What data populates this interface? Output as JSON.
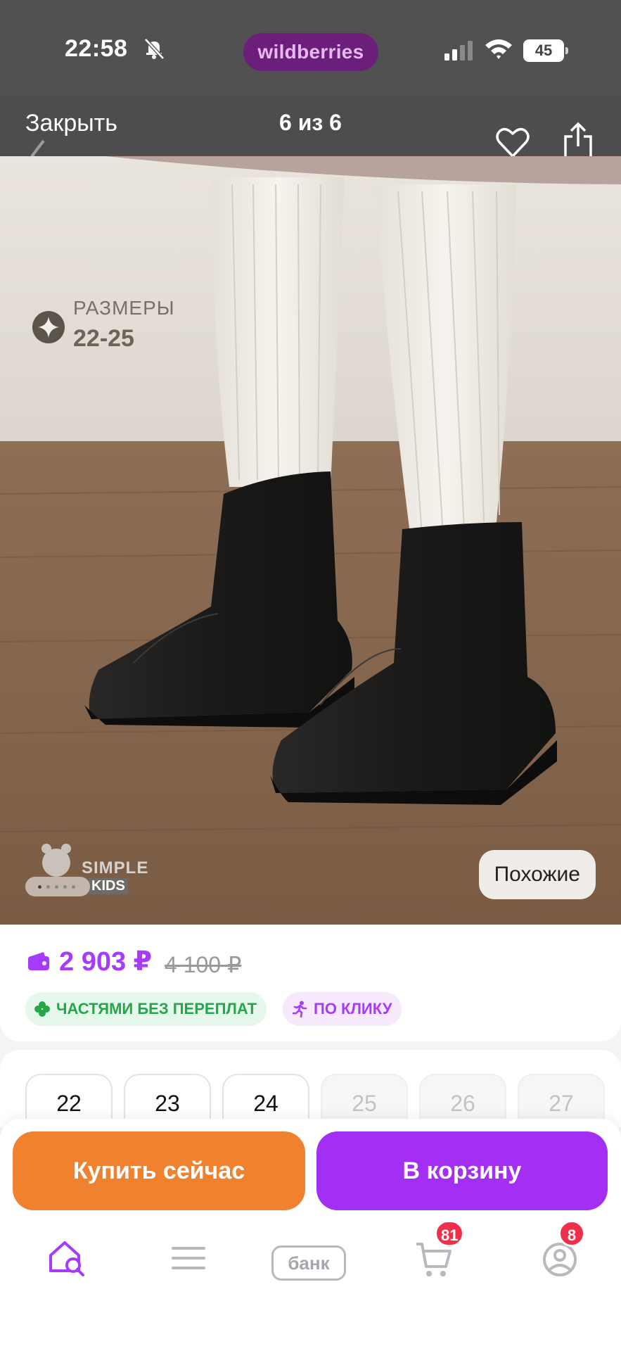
{
  "status_bar": {
    "time": "22:58",
    "brand": "wildberries",
    "battery": "45",
    "colors": {
      "bar": "#515151",
      "brand_pill": "#6b1f7a"
    }
  },
  "top_nav": {
    "close_label": "Закрыть",
    "counter": "6 из 6",
    "icons": [
      "chevron-left-icon",
      "heart-icon",
      "share-icon"
    ]
  },
  "photo": {
    "size_label": "РАЗМЕРЫ",
    "size_range": "22-25",
    "brand_name": "SIMPLE",
    "brand_sub": "KIDS",
    "similar_label": "Похожие"
  },
  "price": {
    "current": "2 903 ₽",
    "old": "4 100 ₽",
    "installments_tag": "ЧАСТЯМИ БЕЗ ПЕРЕПЛАТ",
    "click_tag": "ПО КЛИКУ",
    "colors": {
      "price": "#a73afd",
      "installments": "#26a64a"
    }
  },
  "sizes": [
    {
      "label": "22",
      "available": true
    },
    {
      "label": "23",
      "available": true
    },
    {
      "label": "24",
      "available": true
    },
    {
      "label": "25",
      "available": false
    },
    {
      "label": "26",
      "available": false
    },
    {
      "label": "27",
      "available": false
    }
  ],
  "actions": {
    "buy_now": "Купить сейчас",
    "add_to_cart": "В корзину",
    "colors": {
      "buy_now": "#f0812f",
      "add_to_cart": "#a32ff5"
    }
  },
  "tab_bar": {
    "bank_label": "банк",
    "cart_badge": "81",
    "profile_badge": "8",
    "icons": [
      "home-search-icon",
      "menu-icon",
      "bank-icon",
      "cart-icon",
      "profile-icon"
    ]
  }
}
